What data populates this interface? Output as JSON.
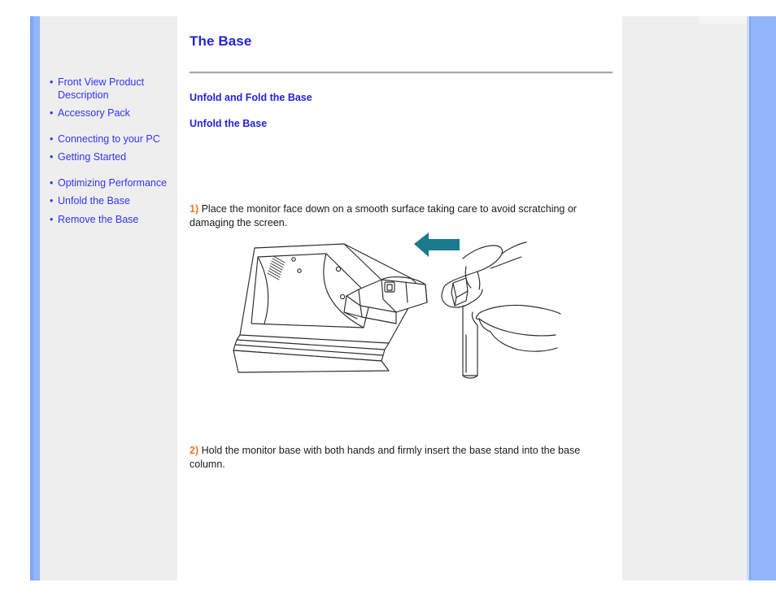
{
  "sidebar": {
    "groups": [
      {
        "items": [
          {
            "label": "Front View Product Description",
            "name": "front-view-product-description"
          },
          {
            "label": "Accessory Pack",
            "name": "accessory-pack"
          }
        ]
      },
      {
        "items": [
          {
            "label": "Connecting to your PC",
            "name": "connecting-to-your-pc"
          },
          {
            "label": "Getting Started",
            "name": "getting-started"
          }
        ]
      },
      {
        "items": [
          {
            "label": "Optimizing Performance",
            "name": "optimizing-performance"
          },
          {
            "label": "Unfold the Base",
            "name": "unfold-the-base"
          },
          {
            "label": "Remove the Base",
            "name": "remove-the-base"
          }
        ]
      }
    ],
    "bullet": "•"
  },
  "main": {
    "title": "The Base",
    "heading_unfold_and_fold": "Unfold and Fold the Base",
    "heading_unfold": "Unfold the Base",
    "step1": {
      "number": "1)",
      "text": " Place the monitor face down on a smooth surface taking care to avoid scratching or damaging the screen."
    },
    "step2": {
      "number": "2)",
      "text": " Hold the monitor base with both hands and firmly insert the base stand into the base column."
    },
    "figure_alt": "monitor-base-assembly-illustration"
  },
  "colors": {
    "link": "#3333ff",
    "heading": "#2323dd",
    "step_number": "#f07820",
    "rail_blue": "#93b5fa",
    "panel_gray": "#eeeeee",
    "arrow_teal": "#1b7b8c"
  }
}
